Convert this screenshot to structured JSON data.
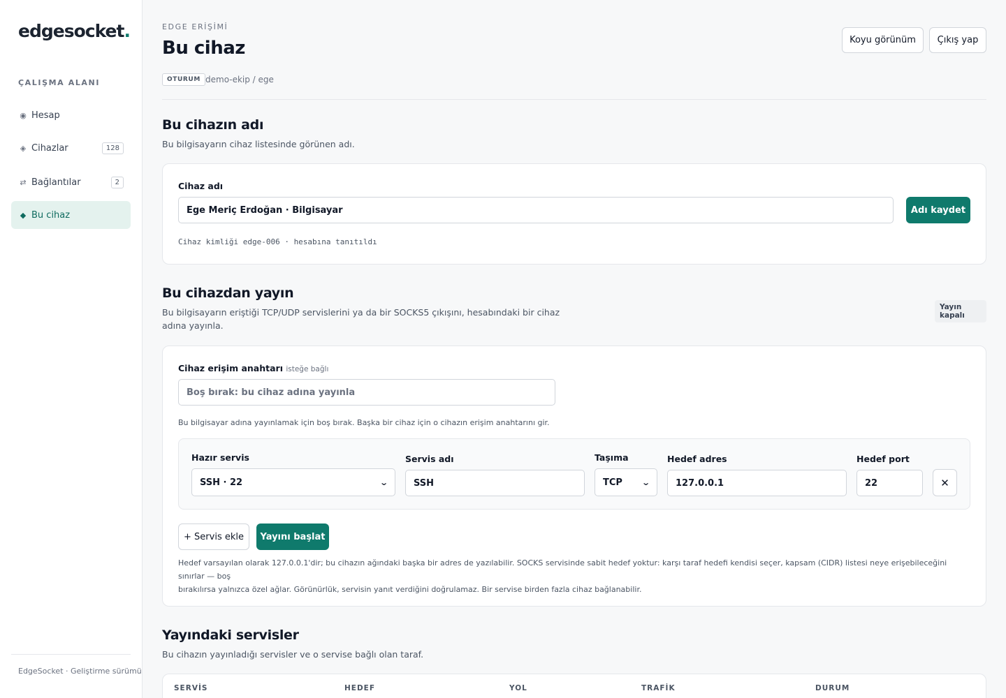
{
  "brand": {
    "name": "edgesocket",
    "dot": "."
  },
  "sidebar": {
    "section": "ÇALIŞMA ALANI",
    "items": [
      {
        "label": "Hesap",
        "icon": "◉",
        "icon_name": "account-icon"
      },
      {
        "label": "Cihazlar",
        "icon": "◈",
        "icon_name": "devices-icon",
        "count": "128"
      },
      {
        "label": "Bağlantılar",
        "icon": "⇄",
        "icon_name": "connections-icon",
        "count": "2"
      },
      {
        "label": "Bu cihaz",
        "icon": "◆",
        "icon_name": "this-device-icon",
        "active": true
      }
    ],
    "footer": "EdgeSocket · Geliştirme sürümü"
  },
  "header": {
    "eyebrow": "EDGE ERİŞİMİ",
    "title": "Bu cihaz",
    "session_badge": "OTURUM",
    "session_path": "demo-ekip / ege",
    "dark_mode_label": "Koyu görünüm",
    "logout_label": "Çıkış yap"
  },
  "device_name": {
    "title": "Bu cihazın adı",
    "description": "Bu bilgisayarın cihaz listesinde görünen adı.",
    "field_label": "Cihaz adı",
    "value": "Ege Meriç Erdoğan · Bilgisayar",
    "save_label": "Adı kaydet",
    "identity_note": "Cihaz kimliği edge-006 · hesabına tanıtıldı"
  },
  "publish": {
    "title": "Bu cihazdan yayın",
    "description_line1": "Bu bilgisayarın eriştiği TCP/UDP servislerini ya da bir SOCKS5 çıkışını, hesabındaki bir cihaz",
    "description_line2": "adına yayınla.",
    "status": "Yayın kapalı",
    "key_label": "Cihaz erişim anahtarı",
    "key_optional": "isteğe bağlı",
    "key_placeholder": "Boş bırak: bu cihaz adına yayınla",
    "key_hint": "Bu bilgisayar adına yayınlamak için boş bırak. Başka bir cihaz için o cihazın erişim anahtarını gir.",
    "service": {
      "preset_label": "Hazır servis",
      "preset_value": "SSH · 22",
      "name_label": "Servis adı",
      "name_value": "SSH",
      "transport_label": "Taşıma",
      "transport_value": "TCP",
      "target_label": "Hedef adres",
      "target_value": "127.0.0.1",
      "port_label": "Hedef port",
      "port_value": "22",
      "remove_symbol": "✕"
    },
    "add_service_label": "+ Servis ekle",
    "start_label": "Yayını başlat",
    "footnote_line1": "Hedef varsayılan olarak 127.0.0.1'dir; bu cihazın ağındaki başka bir adres de yazılabilir. SOCKS servisinde sabit hedef yoktur: karşı taraf hedefi kendisi seçer, kapsam (CIDR) listesi neye erişebileceğini sınırlar — boş",
    "footnote_line2": "bırakılırsa yalnızca özel ağlar. Görünürlük, servisin yanıt verdiğini doğrulamaz. Bir servise birden fazla cihaz bağlanabilir."
  },
  "published": {
    "title": "Yayındaki servisler",
    "description": "Bu cihazın yayınladığı servisler ve o servise bağlı olan taraf.",
    "columns": [
      "SERVİS",
      "HEDEF",
      "YOL",
      "TRAFİK",
      "DURUM"
    ]
  },
  "colors": {
    "accent": "#0f7a6c",
    "active_bg": "#e4f2ee"
  }
}
